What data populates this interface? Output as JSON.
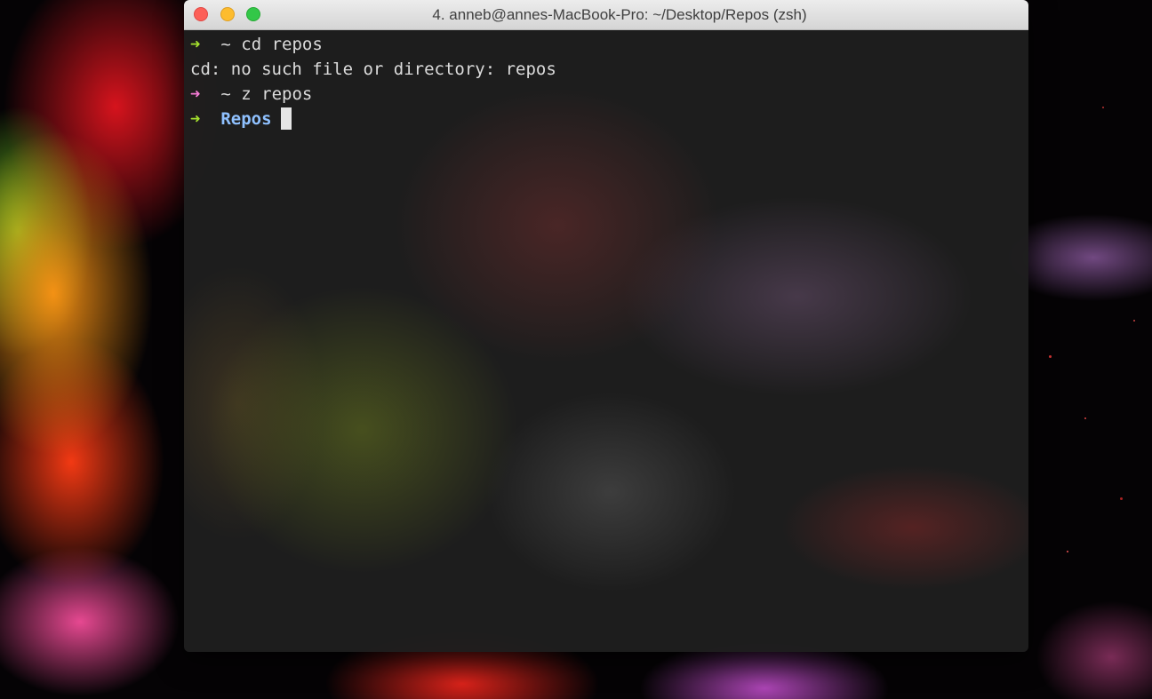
{
  "window": {
    "title": "4. anneb@annes-MacBook-Pro: ~/Desktop/Repos (zsh)"
  },
  "terminal": {
    "lines": [
      {
        "arrow": "➜",
        "arrow_color": "#a6e22e",
        "path": "~",
        "command": "cd repos"
      },
      {
        "output": "cd: no such file or directory: repos"
      },
      {
        "arrow": "➜",
        "arrow_color": "#f77cd6",
        "path": "~",
        "command": "z repos"
      },
      {
        "arrow": "➜",
        "arrow_color": "#a6e22e",
        "path": "Repos",
        "command": ""
      }
    ]
  },
  "icons": {
    "close": "close-icon",
    "minimize": "minimize-icon",
    "zoom": "zoom-icon",
    "prompt": "arrow-right-icon"
  },
  "colors": {
    "close": "#fc5f57",
    "minimize": "#fdbc2e",
    "zoom": "#33c748",
    "directory": "#8fc1ff"
  }
}
